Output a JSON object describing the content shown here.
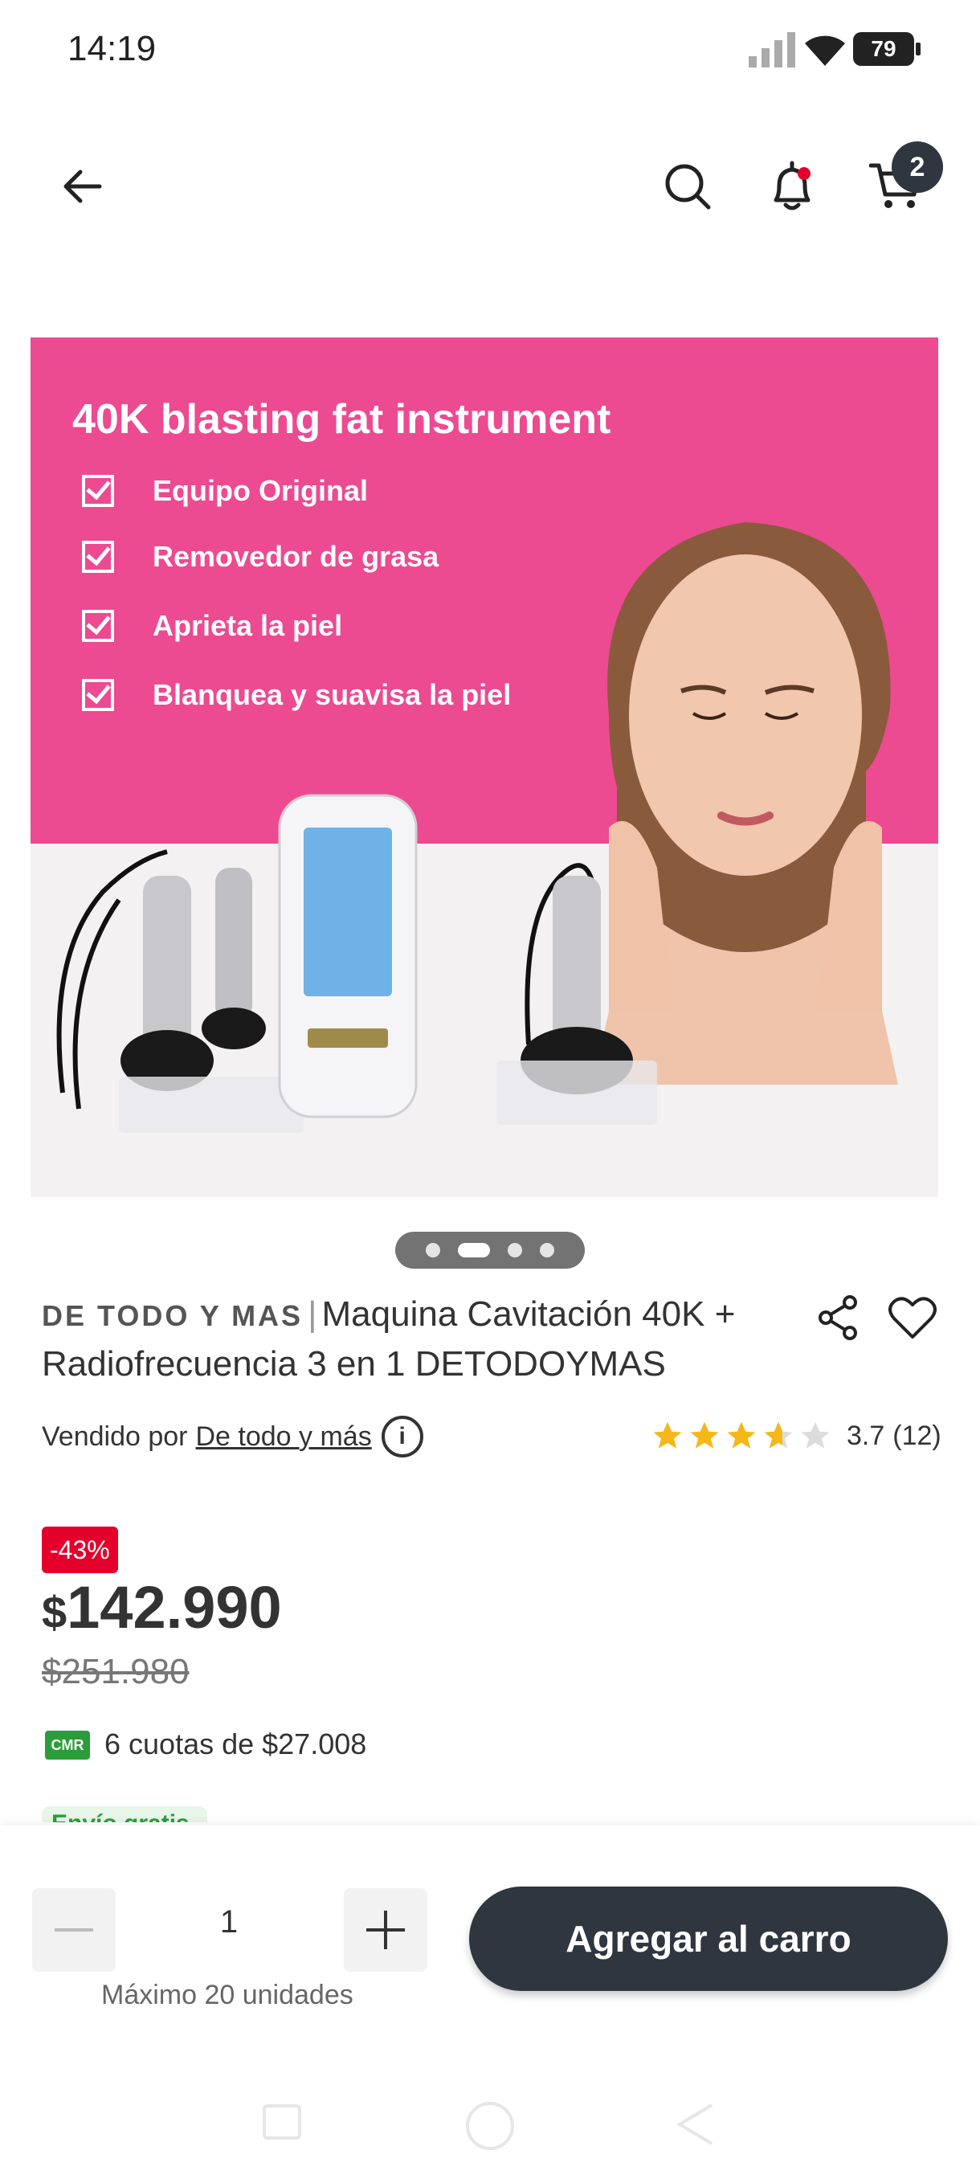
{
  "status_bar": {
    "time": "14:19",
    "battery": "79"
  },
  "header": {
    "cart_count": "2"
  },
  "product_image": {
    "title": "40K blasting fat instrument",
    "features": [
      "Equipo Original",
      "Removedor de grasa",
      "Aprieta la piel",
      "Blanquea y suavisa la piel"
    ],
    "carousel": {
      "total": 4,
      "active": 2
    }
  },
  "product": {
    "brand": "DE TODO Y MAS",
    "name": "Maquina Cavitación 40K + Radiofrecuencia 3 en 1 DETODOYMAS",
    "sold_by_label": "Vendido por",
    "seller": "De todo y más",
    "rating": 3.7,
    "rating_text": "3.7",
    "reviews": "(12)"
  },
  "price": {
    "discount": "-43%",
    "currency": "$",
    "current": "142.990",
    "original": "$251.980",
    "cmr_label": "CMR",
    "installments": "6 cuotas de $27.008",
    "partial_label": "Envío gratis"
  },
  "purchase": {
    "quantity": "1",
    "max_text": "Máximo 20 unidades",
    "add_label": "Agregar al carro"
  },
  "colors": {
    "brand_dark": "#2f3640",
    "discount_red": "#e4002b",
    "cmr_green": "#2a9d3a",
    "banner_pink": "#ec4a91"
  }
}
